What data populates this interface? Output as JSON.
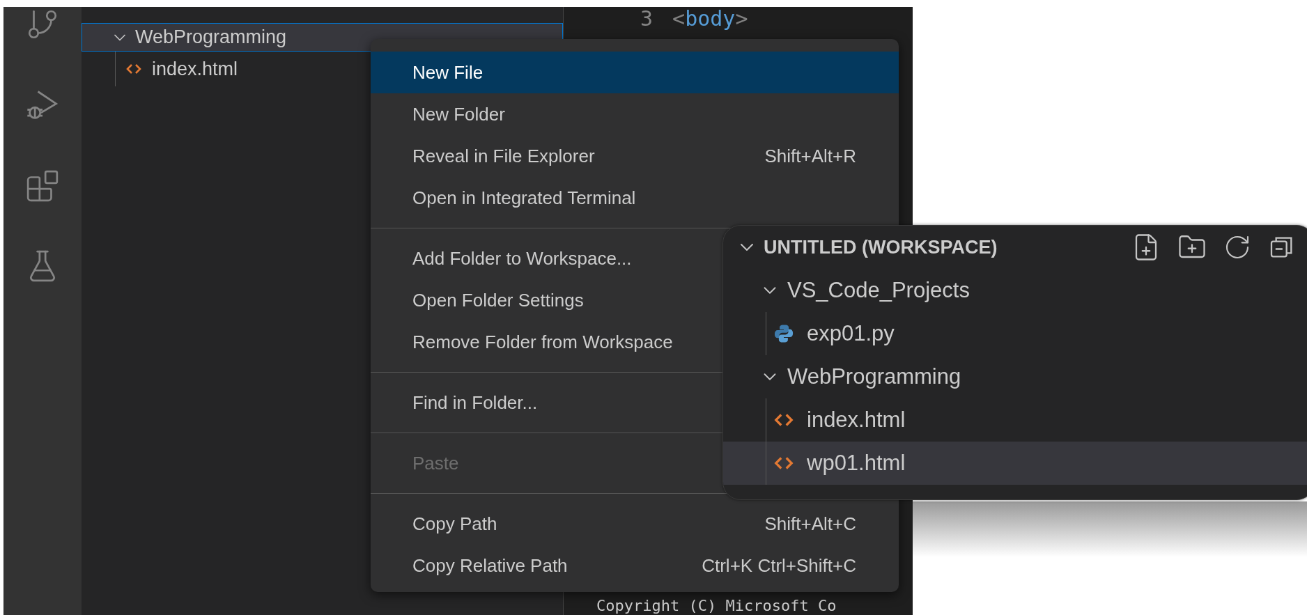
{
  "activity_bar": {
    "items": [
      {
        "kind": "source-control"
      },
      {
        "kind": "run-debug"
      },
      {
        "kind": "extensions"
      },
      {
        "kind": "testing"
      }
    ]
  },
  "explorer": {
    "folder": {
      "name": "WebProgramming",
      "expanded": true,
      "selected": true,
      "children": [
        {
          "name": "index.html",
          "kind": "html"
        }
      ]
    }
  },
  "editor": {
    "lines": [
      {
        "number": "3",
        "code": "<body>"
      }
    ],
    "footer_line": "Copyright (C) Microsoft Co"
  },
  "context_menu": {
    "items": [
      {
        "kind": "item",
        "label": "New File",
        "selected": true,
        "disabled": false
      },
      {
        "kind": "item",
        "label": "New Folder",
        "selected": false,
        "disabled": false
      },
      {
        "kind": "item",
        "label": "Reveal in File Explorer",
        "shortcut": "Shift+Alt+R",
        "selected": false,
        "disabled": false
      },
      {
        "kind": "item",
        "label": "Open in Integrated Terminal",
        "selected": false,
        "disabled": false
      },
      {
        "kind": "separator"
      },
      {
        "kind": "item",
        "label": "Add Folder to Workspace...",
        "selected": false,
        "disabled": false
      },
      {
        "kind": "item",
        "label": "Open Folder Settings",
        "selected": false,
        "disabled": false
      },
      {
        "kind": "item",
        "label": "Remove Folder from Workspace",
        "selected": false,
        "disabled": false
      },
      {
        "kind": "separator"
      },
      {
        "kind": "item",
        "label": "Find in Folder...",
        "selected": false,
        "disabled": false
      },
      {
        "kind": "separator"
      },
      {
        "kind": "item",
        "label": "Paste",
        "selected": false,
        "disabled": true
      },
      {
        "kind": "separator"
      },
      {
        "kind": "item",
        "label": "Copy Path",
        "shortcut": "Shift+Alt+C",
        "selected": false,
        "disabled": false
      },
      {
        "kind": "item",
        "label": "Copy Relative Path",
        "shortcut": "Ctrl+K Ctrl+Shift+C",
        "selected": false,
        "disabled": false
      }
    ]
  },
  "workspace_panel": {
    "title": "UNTITLED (WORKSPACE)",
    "expanded": true,
    "folders": [
      {
        "name": "VS_Code_Projects",
        "expanded": true,
        "children": [
          {
            "name": "exp01.py",
            "kind": "python",
            "selected": false
          }
        ]
      },
      {
        "name": "WebProgramming",
        "expanded": true,
        "children": [
          {
            "name": "index.html",
            "kind": "html",
            "selected": false
          },
          {
            "name": "wp01.html",
            "kind": "html",
            "selected": true
          }
        ]
      }
    ]
  }
}
